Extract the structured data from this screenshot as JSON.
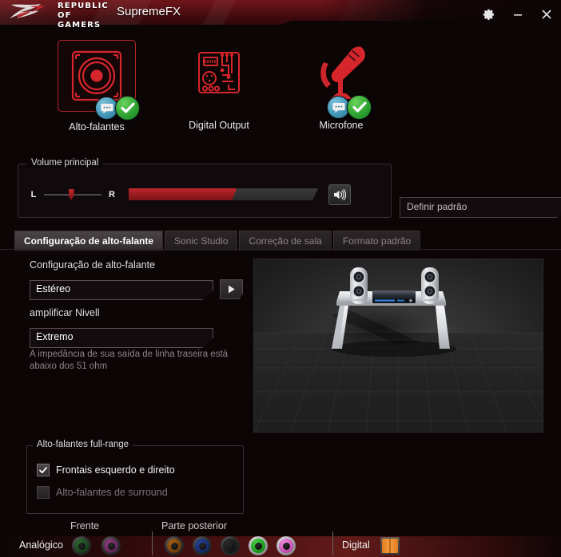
{
  "titlebar": {
    "brand_line1": "REPUBLIC OF",
    "brand_line2": "GAMERS",
    "app_title": "SupremeFX",
    "settings_icon": "gear-icon",
    "minimize_icon": "minimize-icon",
    "close_icon": "close-icon"
  },
  "devices": [
    {
      "label": "Alto-falantes",
      "icon": "speaker-icon",
      "selected": true,
      "badges": [
        "chat-bubble-badge",
        "check-mark-badge"
      ]
    },
    {
      "label": "Digital Output",
      "icon": "digital-output-icon",
      "selected": false,
      "badges": []
    },
    {
      "label": "Microfone",
      "icon": "microphone-icon",
      "selected": false,
      "badges": [
        "chat-bubble-badge",
        "check-mark-badge"
      ]
    }
  ],
  "volume": {
    "legend": "Volume principal",
    "left_label": "L",
    "right_label": "R",
    "balance_percent": 45,
    "level_percent": 57,
    "mute_icon": "speaker-volume-icon"
  },
  "default_button": {
    "label": "Definir padrão"
  },
  "tabs": [
    {
      "label": "Configuração de alto-falante",
      "active": true
    },
    {
      "label": "Sonic Studio",
      "active": false
    },
    {
      "label": "Correção de sala",
      "active": false
    },
    {
      "label": "Formato padrão",
      "active": false
    }
  ],
  "speaker_config": {
    "config_label": "Configuração de alto-falante",
    "config_value": "Estéreo",
    "play_icon": "play-icon",
    "amplify_label": "amplificar Nivell",
    "amplify_value": "Extremo",
    "hint": "A impedância de sua saída de linha traseira está abaixo dos 51 ohm"
  },
  "full_range": {
    "legend": "Alto-falantes full-range",
    "items": [
      {
        "label": "Frontais esquerdo e direito",
        "checked": true,
        "enabled": true
      },
      {
        "label": "Alto-falantes de surround",
        "checked": false,
        "enabled": false
      }
    ]
  },
  "jack_panel": {
    "analog_label": "Analógico",
    "front_label": "Frente",
    "rear_label": "Parte posterior",
    "digital_label": "Digital",
    "optical_icon": "optical-spdif-icon",
    "front_jacks": [
      {
        "name": "jack-front-headphone",
        "color": "#1e5622",
        "active": false
      },
      {
        "name": "jack-front-mic",
        "color": "#6e2a62",
        "active": false
      }
    ],
    "rear_jacks": [
      {
        "name": "jack-rear-center-sub",
        "color": "#8a4a12",
        "active": false
      },
      {
        "name": "jack-rear-surround",
        "color": "#1b2f6e",
        "active": false
      },
      {
        "name": "jack-rear-side",
        "color": "#1c1c1c",
        "active": false
      },
      {
        "name": "jack-rear-line-out",
        "color": "#18a01c",
        "active": true
      },
      {
        "name": "jack-rear-mic-in",
        "color": "#d45bc0",
        "active": true
      }
    ]
  },
  "colors": {
    "rog_red": "#b3262b",
    "accent_red": "#c0292e",
    "panel_bg": "#0b0506"
  }
}
